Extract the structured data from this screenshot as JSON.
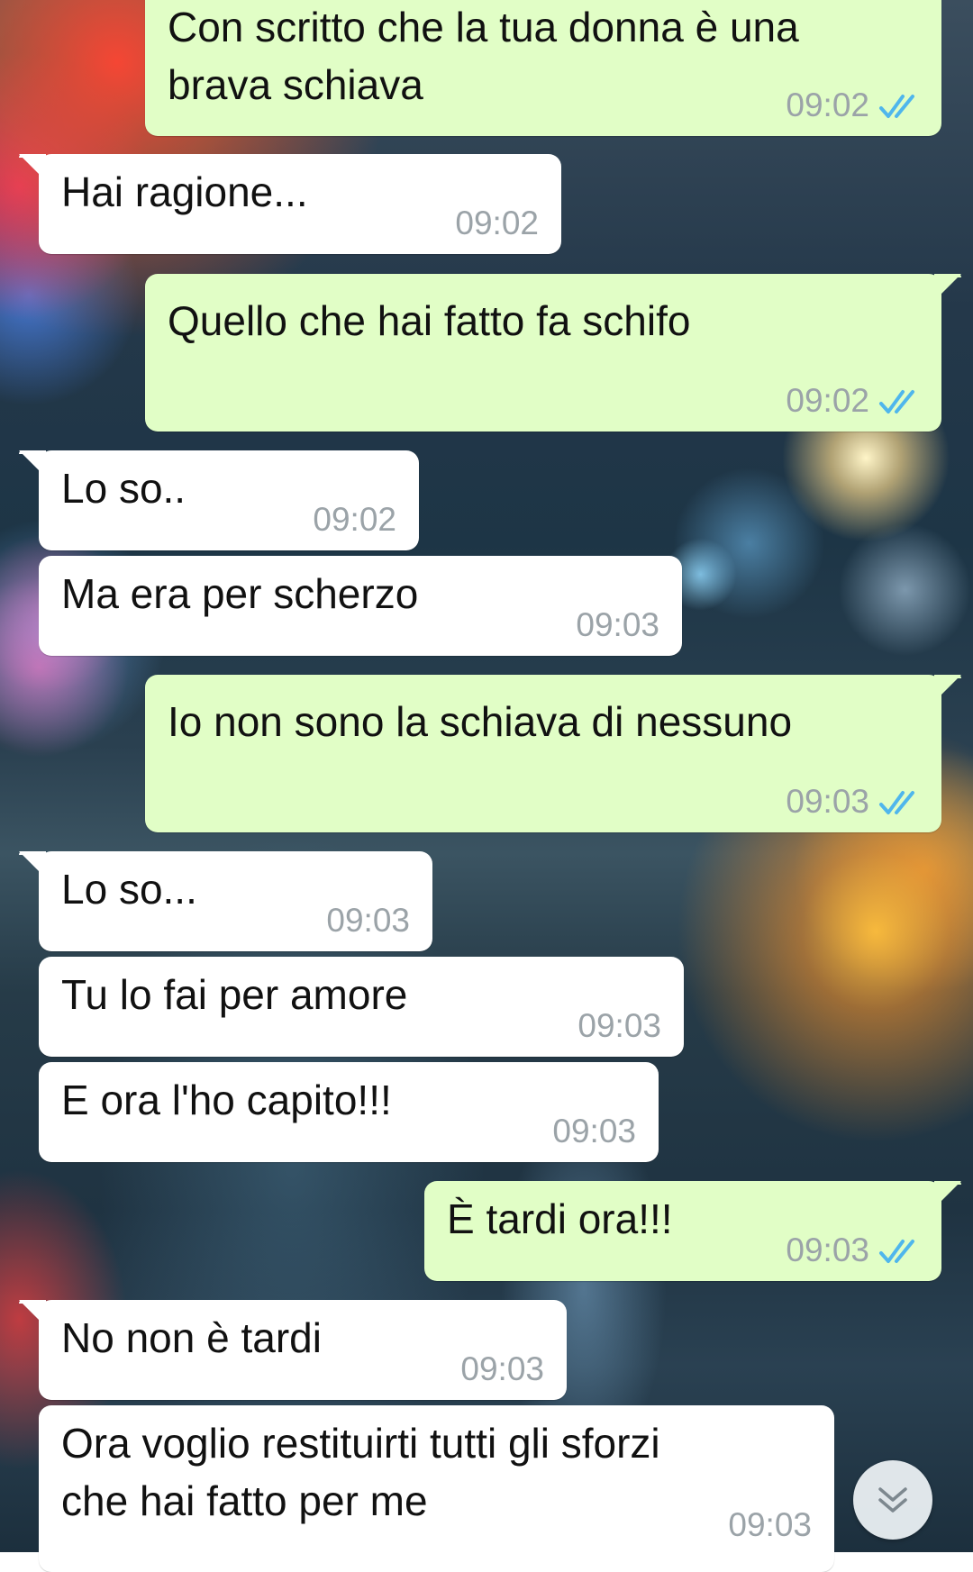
{
  "messages": [
    {
      "direction": "outgoing",
      "text": "Con scritto che la tua donna è una\nbrava schiava",
      "time": "09:02",
      "status": "read"
    },
    {
      "direction": "incoming",
      "text": "Hai ragione...",
      "time": "09:02"
    },
    {
      "direction": "outgoing",
      "text": "Quello che hai fatto fa schifo",
      "time": "09:02",
      "status": "read"
    },
    {
      "direction": "incoming",
      "text": "Lo so..",
      "time": "09:02"
    },
    {
      "direction": "incoming",
      "text": "Ma era per scherzo",
      "time": "09:03"
    },
    {
      "direction": "outgoing",
      "text": "Io non sono la schiava di nessuno",
      "time": "09:03",
      "status": "read"
    },
    {
      "direction": "incoming",
      "text": "Lo so...",
      "time": "09:03"
    },
    {
      "direction": "incoming",
      "text": "Tu lo fai per amore",
      "time": "09:03"
    },
    {
      "direction": "incoming",
      "text": "E ora l'ho capito!!!",
      "time": "09:03"
    },
    {
      "direction": "outgoing",
      "text": "È tardi ora!!!",
      "time": "09:03",
      "status": "read"
    },
    {
      "direction": "incoming",
      "text": "No non è tardi",
      "time": "09:03"
    },
    {
      "direction": "incoming",
      "text": "Ora voglio restituirti tutti gli sforzi\nche hai fatto per me",
      "time": "09:03"
    }
  ],
  "scroll_button": {
    "icon": "double-chevron-down-icon"
  },
  "colors": {
    "outgoing_bubble": "#e1fec6",
    "incoming_bubble": "#ffffff",
    "timestamp": "#9ba3a8",
    "read_ticks": "#4fb6ec"
  }
}
